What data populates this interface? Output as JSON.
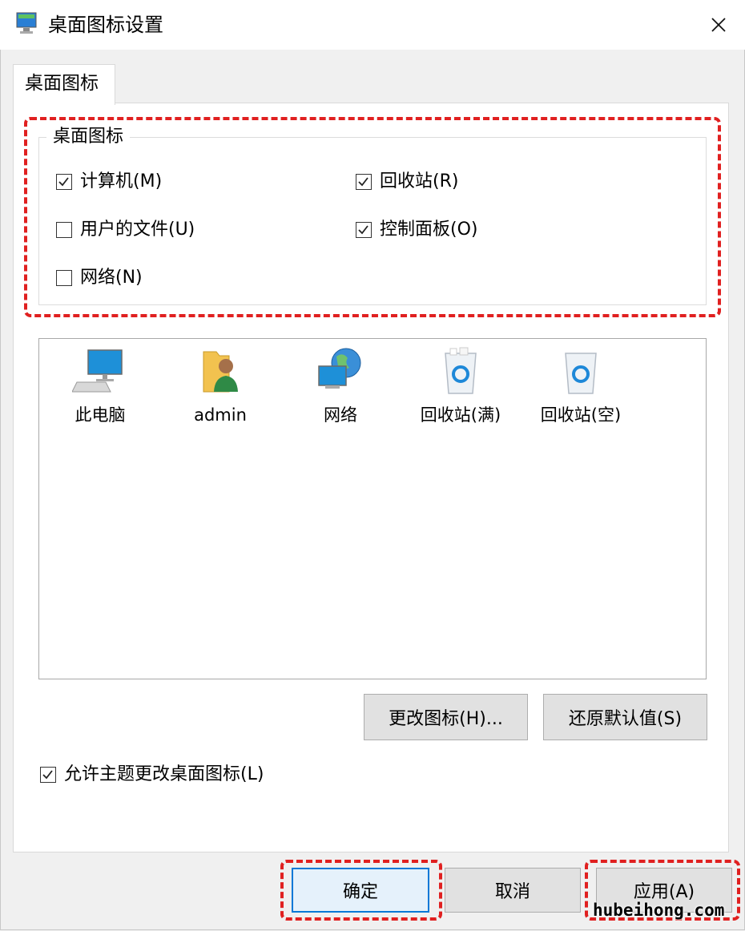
{
  "window": {
    "title": "桌面图标设置"
  },
  "tab": {
    "label": "桌面图标"
  },
  "group": {
    "legend": "桌面图标",
    "options": [
      {
        "label": "计算机(M)",
        "checked": true
      },
      {
        "label": "回收站(R)",
        "checked": true
      },
      {
        "label": "用户的文件(U)",
        "checked": false
      },
      {
        "label": "控制面板(O)",
        "checked": true
      },
      {
        "label": "网络(N)",
        "checked": false
      }
    ]
  },
  "icons": [
    {
      "label": "此电脑",
      "icon": "computer-icon"
    },
    {
      "label": "admin",
      "icon": "user-folder-icon"
    },
    {
      "label": "网络",
      "icon": "network-icon"
    },
    {
      "label": "回收站(满)",
      "icon": "recycle-bin-full-icon"
    },
    {
      "label": "回收站(空)",
      "icon": "recycle-bin-empty-icon"
    }
  ],
  "buttons": {
    "change_icon": "更改图标(H)...",
    "restore_default": "还原默认值(S)",
    "ok": "确定",
    "cancel": "取消",
    "apply": "应用(A)"
  },
  "allow_themes": {
    "label": "允许主题更改桌面图标(L)",
    "checked": true
  },
  "watermark": "hubeihong.com",
  "colors": {
    "highlight": "#e02020",
    "accent": "#0078d7"
  }
}
